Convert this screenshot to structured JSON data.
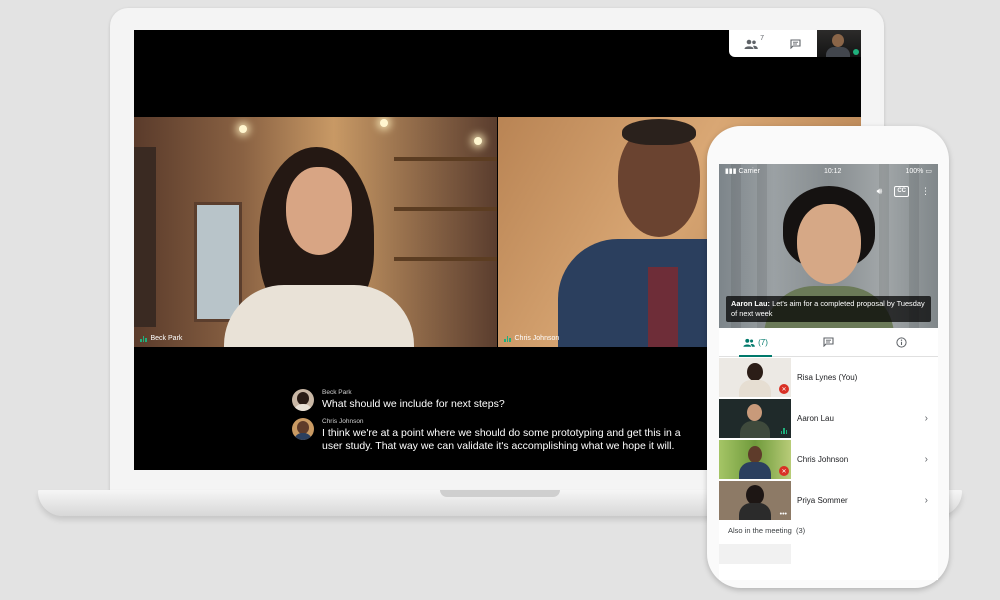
{
  "meeting": {
    "participants_count": "7",
    "top_panel": {
      "people_icon": "people-icon",
      "chat_icon": "chat-icon"
    },
    "tiles": [
      {
        "name": "Beck Park"
      },
      {
        "name": "Chris Johnson"
      }
    ],
    "captions": [
      {
        "speaker": "Beck Park",
        "text": "What should we include for next steps?"
      },
      {
        "speaker": "Chris Johnson",
        "text": "I think we're at a point where we should do some prototyping and get this in a user study. That way we can validate it's accomplishing what we hope it will."
      }
    ]
  },
  "phone": {
    "status": {
      "carrier": "Carrier",
      "time": "10:12",
      "battery": "100%"
    },
    "caption": {
      "speaker": "Aaron Lau:",
      "text": "Let's aim for a completed proposal by Tuesday of next week"
    },
    "tabs": {
      "people_count": "(7)"
    },
    "participants": [
      {
        "name": "Risa Lynes (You)"
      },
      {
        "name": "Aaron Lau"
      },
      {
        "name": "Chris Johnson"
      },
      {
        "name": "Priya Sommer"
      }
    ],
    "also_in_meeting": {
      "label": "Also in the meeting",
      "count": "(3)"
    }
  },
  "colors": {
    "accent": "#00796b",
    "speaking": "#1fb07c",
    "muted": "#d93025"
  }
}
